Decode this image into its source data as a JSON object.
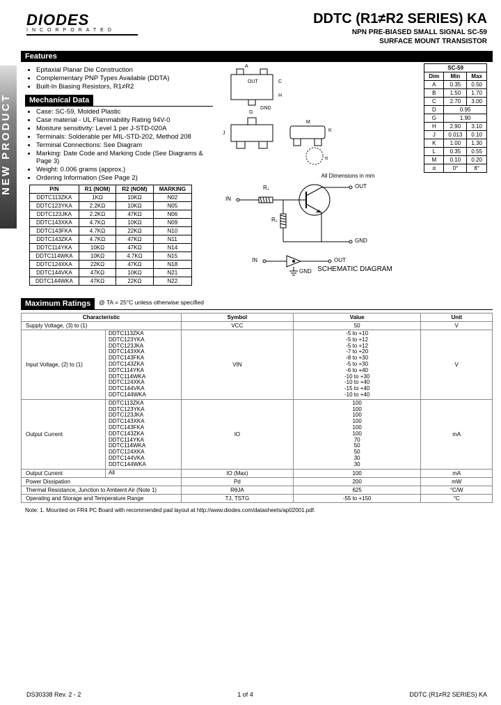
{
  "header": {
    "logo": "DIODES",
    "logo_sub": "INCORPORATED",
    "title_main": "DDTC (R1≠R2 SERIES) KA",
    "title_sub1": "NPN PRE-BIASED SMALL SIGNAL SC-59",
    "title_sub2": "SURFACE MOUNT TRANSISTOR"
  },
  "sidebar_text": "NEW PRODUCT",
  "sections": {
    "features": "Features",
    "mechanical": "Mechanical Data",
    "maximum": "Maximum Ratings"
  },
  "features_list": [
    "Epitaxial Planar Die Construction",
    "Complementary PNP Types Available (DDTA)",
    "Built-In Biasing Resistors, R1≠R2"
  ],
  "mechanical_list": [
    "Case: SC-59, Molded Plastic",
    "Case material - UL Flammability Rating 94V-0",
    "Moisture sensitivity: Level 1 per J-STD-020A",
    "Terminals: Solderable per MIL-STD-202, Method 208",
    "Terminal Connections: See Diagram",
    "Marking: Date Code and Marking Code (See Diagrams & Page 3)",
    "Weight: 0.006 grams (approx.)",
    "Ordering Information (See Page 2)"
  ],
  "dim_table": {
    "title": "SC-59",
    "headers": [
      "Dim",
      "Min",
      "Max"
    ],
    "rows": [
      [
        "A",
        "0.35",
        "0.50"
      ],
      [
        "B",
        "1.50",
        "1.70"
      ],
      [
        "C",
        "2.70",
        "3.00"
      ],
      [
        "D",
        "0.95",
        ""
      ],
      [
        "G",
        "1.90",
        ""
      ],
      [
        "H",
        "2.90",
        "3.10"
      ],
      [
        "J",
        "0.013",
        "0.10"
      ],
      [
        "K",
        "1.00",
        "1.30"
      ],
      [
        "L",
        "0.35",
        "0.55"
      ],
      [
        "M",
        "0.10",
        "0.20"
      ],
      [
        "α",
        "0°",
        "8°"
      ]
    ],
    "caption": "All Dimensions in mm"
  },
  "pn_table": {
    "headers": [
      "P/N",
      "R1 (NOM)",
      "R2 (NOM)",
      "MARKING"
    ],
    "rows": [
      [
        "DDTC113ZKA",
        "1KΩ",
        "10KΩ",
        "N02"
      ],
      [
        "DDTC123YKA",
        "2.2KΩ",
        "10KΩ",
        "N05"
      ],
      [
        "DDTC123JKA",
        "2.2KΩ",
        "47KΩ",
        "N06"
      ],
      [
        "DDTC143XKA",
        "4.7KΩ",
        "10KΩ",
        "N09"
      ],
      [
        "DDTC143FKA",
        "4.7KΩ",
        "22KΩ",
        "N10"
      ],
      [
        "DDTC143ZKA",
        "4.7KΩ",
        "47KΩ",
        "N11"
      ],
      [
        "DDTC114YKA",
        "10KΩ",
        "47KΩ",
        "N14"
      ],
      [
        "DDTC114WKA",
        "10KΩ",
        "4.7KΩ",
        "N15"
      ],
      [
        "DDTC124XKA",
        "22KΩ",
        "47KΩ",
        "N18"
      ],
      [
        "DDTC144VKA",
        "47KΩ",
        "10KΩ",
        "N21"
      ],
      [
        "DDTC144WKA",
        "47KΩ",
        "22KΩ",
        "N22"
      ]
    ]
  },
  "schematic": {
    "in": "IN",
    "out": "OUT",
    "gnd": "GND",
    "r1": "R₁",
    "r2": "R₂",
    "label": "SCHEMATIC DIAGRAM"
  },
  "max_ratings": {
    "condition": "@ TA = 25°C unless otherwise specified",
    "headers": [
      "Characteristic",
      "Symbol",
      "Value",
      "Unit"
    ],
    "rows": [
      {
        "char": "Supply Voltage, (3) to (1)",
        "models": "",
        "sym": "VCC",
        "val": "50",
        "unit": "V"
      },
      {
        "char": "Input Voltage, (2) to (1)",
        "models": "DDTC113ZKA\nDDTC123YKA\nDDTC123JKA\nDDTC143XKA\nDDTC143FKA\nDDTC143ZKA\nDDTC114YKA\nDDTC114WKA\nDDTC124XKA\nDDTC144VKA\nDDTC144WKA",
        "sym": "VIN",
        "val": "-5 to +10\n-5 to +12\n-5 to +12\n-7 to +20\n-8 to +30\n-5 to +30\n-6 to +40\n-10 to +30\n-10 to +40\n-15 to +40\n-10 to +40",
        "unit": "V"
      },
      {
        "char": "Output Current",
        "models": "DDTC113ZKA\nDDTC123YKA\nDDTC123JKA\nDDTC143XKA\nDDTC143FKA\nDDTC143ZKA\nDDTC114YKA\nDDTC114WKA\nDDTC124XKA\nDDTC144VKA\nDDTC144WKA",
        "sym": "IO",
        "val": "100\n100\n100\n100\n100\n100\n70\n50\n50\n30\n30",
        "unit": "mA"
      },
      {
        "char": "Output Current",
        "models": "All",
        "sym": "IO (Max)",
        "val": "100",
        "unit": "mA"
      },
      {
        "char": "Power Dissipation",
        "models": "",
        "sym": "Pd",
        "val": "200",
        "unit": "mW"
      },
      {
        "char": "Thermal Resistance, Junction to Ambient Air (Note 1)",
        "models": "",
        "sym": "RθJA",
        "val": "625",
        "unit": "°C/W"
      },
      {
        "char": "Operating and Storage and Temperature Range",
        "models": "",
        "sym": "TJ, TSTG",
        "val": "-55 to +150",
        "unit": "°C"
      }
    ]
  },
  "footnote": {
    "label": "Note:",
    "text": "1. Mounted on FR4 PC Board with recommended pad layout at http://www.diodes.com/datasheets/ap02001.pdf."
  },
  "footer": {
    "left": "DS30338 Rev. 2 - 2",
    "mid": "1 of 4",
    "right": "DDTC (R1≠R2 SERIES) KA"
  }
}
